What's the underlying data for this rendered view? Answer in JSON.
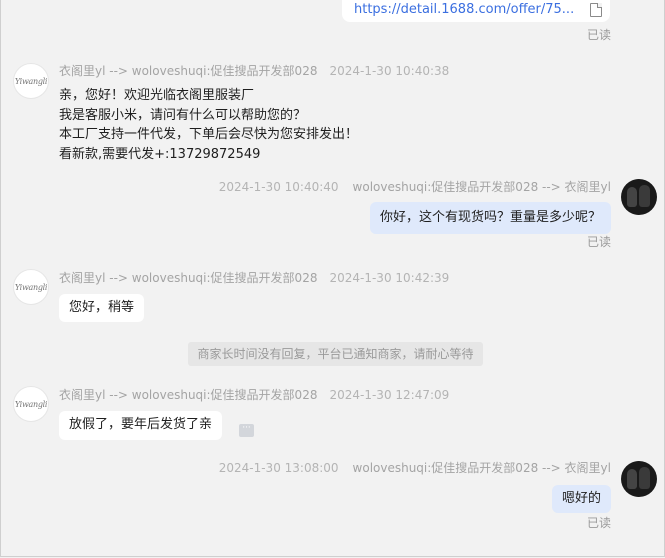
{
  "link_card": {
    "url": "https://detail.1688.com/offer/75..."
  },
  "read_label": "已读",
  "seller": {
    "name": "衣阁里yl --> woloveshuqi:促佳搜品开发部028",
    "avatar_text": "Yiwangli"
  },
  "user": {
    "name": "woloveshuqi:促佳搜品开发部028 --> 衣阁里yl"
  },
  "messages": [
    {
      "side": "in",
      "time": "2024-1-30 10:40:38",
      "lines": [
        "亲，您好！欢迎光临衣阁里服装厂",
        "我是客服小米，请问有什么可以帮助您的？",
        "本工厂支持一件代发，下单后会尽快为您安排发出！",
        "看新款,需要代发+:13729872549"
      ]
    },
    {
      "side": "out",
      "time": "2024-1-30 10:40:40",
      "text": "你好，这个有现货吗？重量是多少呢？",
      "status": "已读"
    },
    {
      "side": "in",
      "time": "2024-1-30 10:42:39",
      "text": "您好，稍等"
    },
    {
      "side": "in",
      "time": "2024-1-30 12:47:09",
      "text": "放假了，要年后发货了亲"
    },
    {
      "side": "out",
      "time": "2024-1-30 13:08:00",
      "text": "嗯好的",
      "status": "已读"
    }
  ],
  "system_notice": "商家长时间没有回复，平台已通知商家，请耐心等待"
}
